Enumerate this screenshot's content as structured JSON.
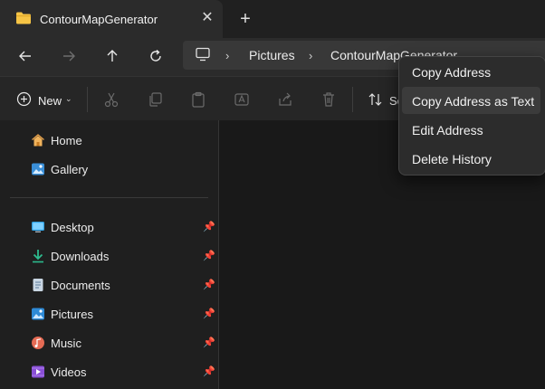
{
  "tab": {
    "title": "ContourMapGenerator",
    "close": "✕",
    "new_tab": "+"
  },
  "breadcrumb": {
    "items": [
      "Pictures",
      "ContourMapGenerator"
    ],
    "separator": "›"
  },
  "toolbar": {
    "new_label": "New",
    "sort_label": "So"
  },
  "sidebar": {
    "quick": [
      {
        "label": "Home",
        "icon": "home-icon"
      },
      {
        "label": "Gallery",
        "icon": "gallery-icon"
      }
    ],
    "pinned": [
      {
        "label": "Desktop",
        "icon": "desktop-icon"
      },
      {
        "label": "Downloads",
        "icon": "downloads-icon"
      },
      {
        "label": "Documents",
        "icon": "documents-icon"
      },
      {
        "label": "Pictures",
        "icon": "pictures-icon"
      },
      {
        "label": "Music",
        "icon": "music-icon"
      },
      {
        "label": "Videos",
        "icon": "videos-icon"
      }
    ]
  },
  "context_menu": {
    "items": [
      "Copy Address",
      "Copy Address as Text",
      "Edit Address",
      "Delete History"
    ],
    "highlighted": "Copy Address as Text"
  },
  "colors": {
    "folder": "#f6c445",
    "accent": "#4aa8f0",
    "menu_bg": "#2c2c2c"
  }
}
